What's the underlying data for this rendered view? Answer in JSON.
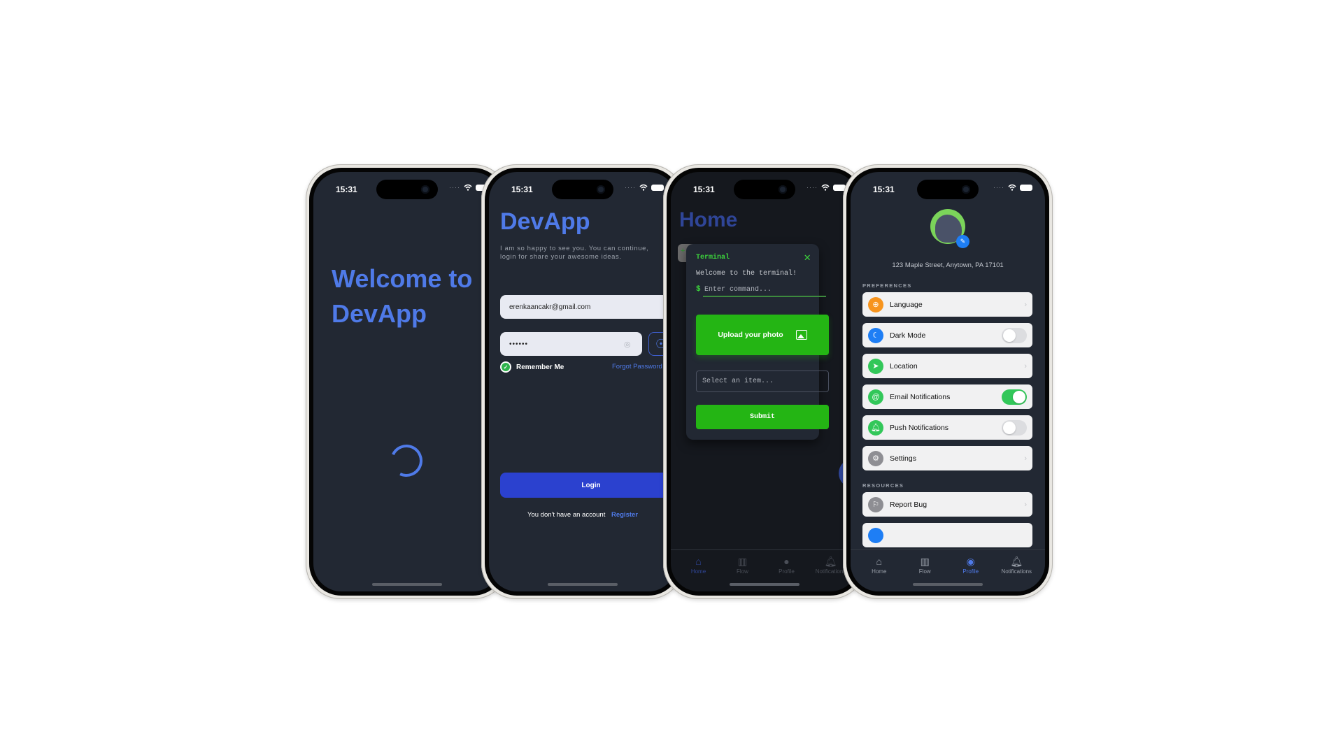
{
  "status_bar": {
    "time": "15:31"
  },
  "splash": {
    "title_line1": "Welcome to",
    "title_line2": "DevApp",
    "accent": "#4f7ae8"
  },
  "login": {
    "title": "DevApp",
    "subtitle_line1": "I am so happy to see you. You can continue,",
    "subtitle_line2": "login for share your awesome ideas.",
    "email_value": "erenkaancakr@gmail.com",
    "password_masked": "••••••",
    "remember_me_label": "Remember Me",
    "remember_me_checked": true,
    "forgot_password_label": "Forgot Password",
    "login_button": "Login",
    "no_account_text": "You don't have an account",
    "register_link": "Register",
    "button_color": "#2b41cf"
  },
  "home": {
    "title": "Home",
    "terminal": {
      "title": "Terminal",
      "welcome": "Welcome to the terminal!",
      "prompt": "$",
      "input_placeholder": "Enter command...",
      "upload_button": "Upload your photo",
      "select_placeholder": "Select an item...",
      "submit_button": "Submit",
      "accent": "#24b514"
    },
    "add_label": "+",
    "tabs": [
      {
        "label": "Home",
        "icon": "home-icon",
        "active": true
      },
      {
        "label": "Flow",
        "icon": "flow-icon",
        "active": false
      },
      {
        "label": "Profile",
        "icon": "profile-icon",
        "active": false
      },
      {
        "label": "Notifications",
        "icon": "bell-icon",
        "active": false
      }
    ]
  },
  "profile": {
    "address": "123 Maple Street, Anytown, PA 17101",
    "preferences_label": "PREFERENCES",
    "resources_label": "RESOURCES",
    "preferences": [
      {
        "label": "Language",
        "icon": "globe-icon",
        "color": "#f7941d",
        "control": "chevron"
      },
      {
        "label": "Dark Mode",
        "icon": "moon-icon",
        "color": "#1e7ef5",
        "control": "toggle",
        "on": false
      },
      {
        "label": "Location",
        "icon": "location-arrow-icon",
        "color": "#32c759",
        "control": "chevron"
      },
      {
        "label": "Email Notifications",
        "icon": "at-icon",
        "color": "#32c759",
        "control": "toggle",
        "on": true
      },
      {
        "label": "Push Notifications",
        "icon": "bell-icon",
        "color": "#32c759",
        "control": "toggle",
        "on": false
      },
      {
        "label": "Settings",
        "icon": "gear-icon",
        "color": "#8e8e93",
        "control": "chevron"
      }
    ],
    "resources": [
      {
        "label": "Report Bug",
        "icon": "flag-icon",
        "color": "#8e8e93",
        "control": "chevron"
      }
    ],
    "tabs": [
      {
        "label": "Home",
        "icon": "home-icon",
        "active": false
      },
      {
        "label": "Flow",
        "icon": "flow-icon",
        "active": false
      },
      {
        "label": "Profile",
        "icon": "profile-icon",
        "active": true
      },
      {
        "label": "Notifications",
        "icon": "bell-icon",
        "active": false
      }
    ]
  }
}
